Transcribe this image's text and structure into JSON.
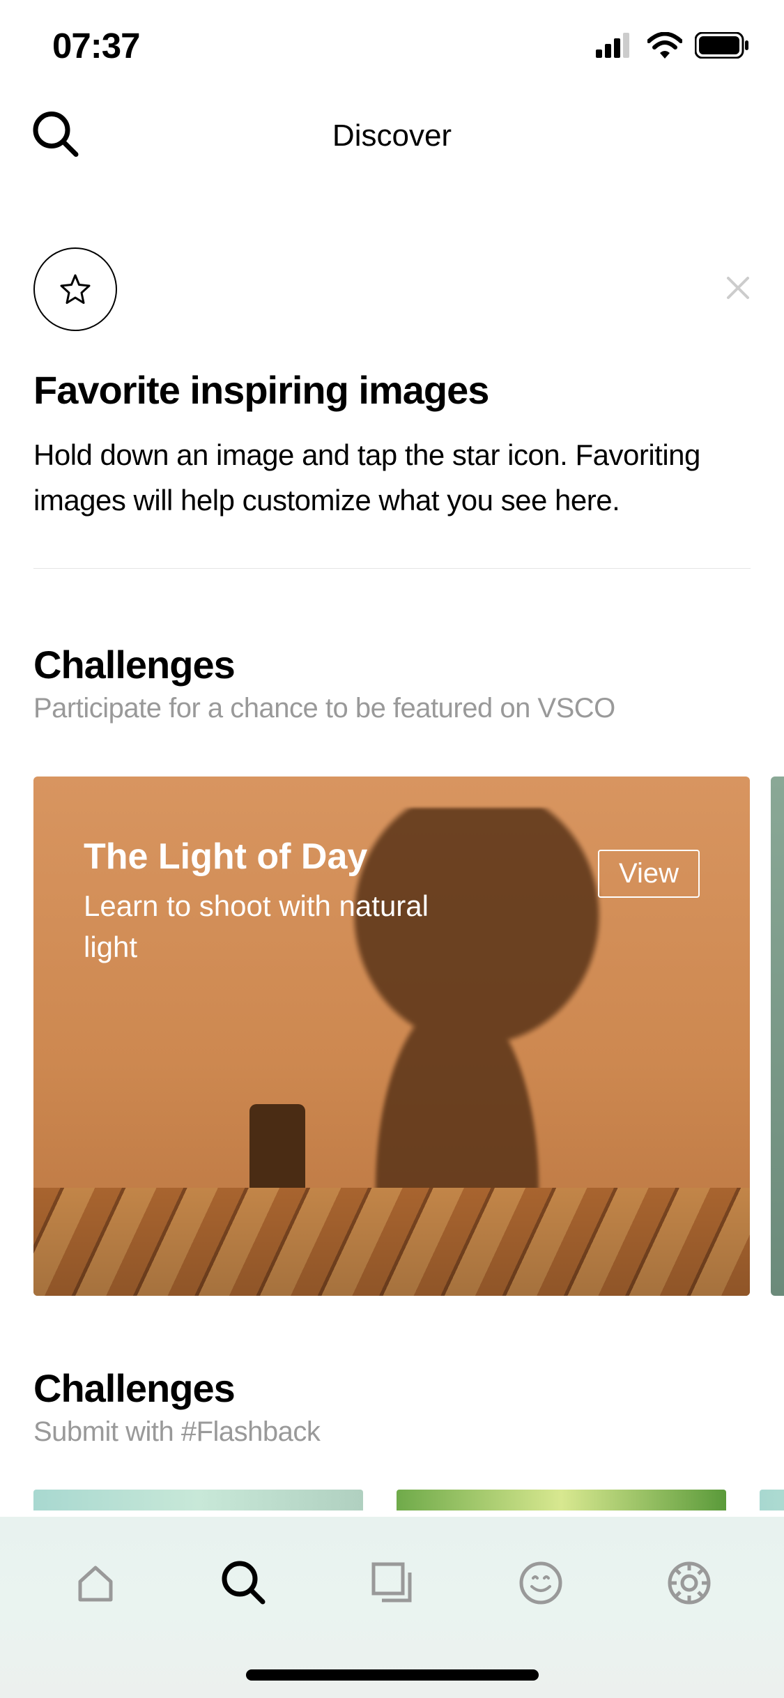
{
  "status": {
    "time": "07:37"
  },
  "header": {
    "title": "Discover"
  },
  "tip": {
    "title": "Favorite inspiring images",
    "description": "Hold down an image and tap the star icon. Favoriting images will help customize what you see here."
  },
  "challenges": {
    "title": "Challenges",
    "subtitle": "Participate for a chance to be featured on VSCO",
    "cards": [
      {
        "title": "The Light of Day",
        "description": "Learn to shoot with natural light",
        "button": "View"
      }
    ]
  },
  "challenges2": {
    "title": "Challenges",
    "subtitle": "Submit with #Flashback"
  },
  "tabs": [
    "home",
    "discover",
    "studio",
    "feed",
    "profile"
  ]
}
